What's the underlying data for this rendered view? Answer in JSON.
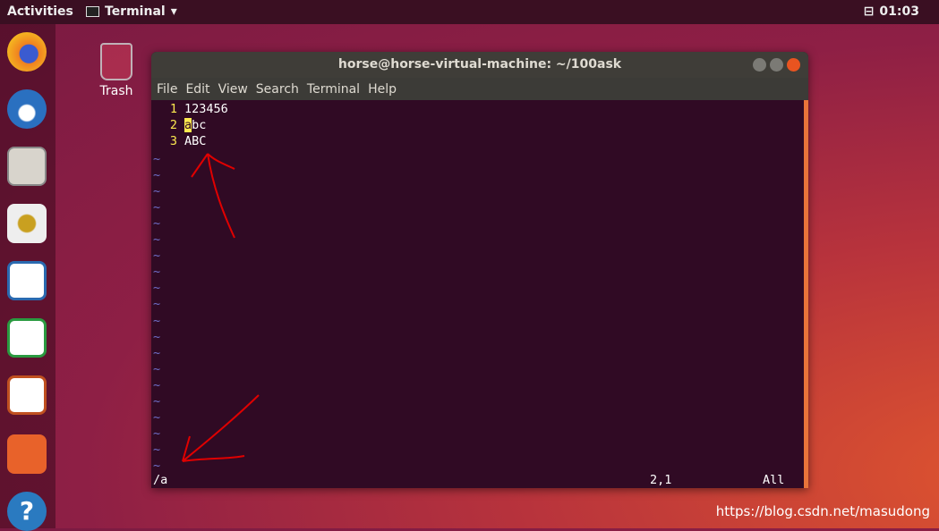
{
  "topbar": {
    "activities": "Activities",
    "app": "Terminal",
    "app_arrow": "▾",
    "battery_icon": "⊟",
    "clock": "01:03",
    "menu_arrow": "▾"
  },
  "desktop": {
    "trash_label": "Trash"
  },
  "dock": {
    "items": [
      "firefox",
      "thunderbird",
      "files",
      "rhythmbox",
      "libreoffice-writer",
      "libreoffice-calc",
      "libreoffice-impress",
      "software-center",
      "help"
    ],
    "help_glyph": "?"
  },
  "window": {
    "title": "horse@horse-virtual-machine: ~/100ask",
    "menu": [
      "File",
      "Edit",
      "View",
      "Search",
      "Terminal",
      "Help"
    ],
    "lines": [
      {
        "num": "1",
        "text": "123456"
      },
      {
        "num": "2",
        "cursor": "a",
        "text": "bc"
      },
      {
        "num": "3",
        "text": "ABC"
      }
    ],
    "tilde": "~",
    "command": "/a",
    "position": "2,1",
    "scroll": "All"
  },
  "watermark": "https://blog.csdn.net/masudong",
  "colors": {
    "terminal_bg": "#300a24",
    "line_number": "#fce94f",
    "annotation": "#e00000"
  }
}
